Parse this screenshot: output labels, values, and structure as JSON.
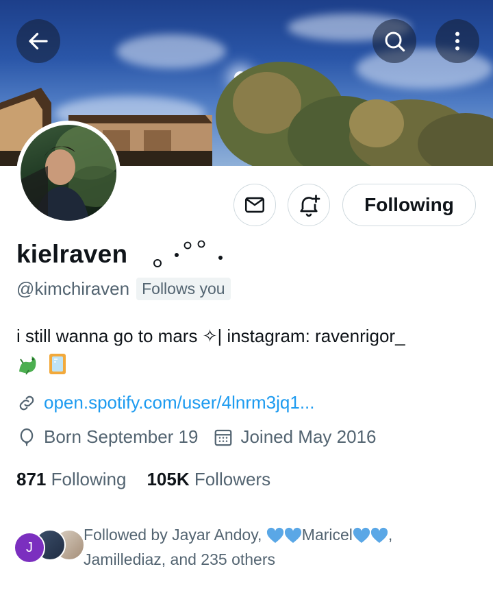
{
  "profile": {
    "display_name": "kielraven",
    "handle": "@kimchiraven",
    "follows_you_label": "Follows you",
    "bio": "i still wanna go to mars ✧| instagram: ravenrigor_",
    "bio_emoji": [
      "dragon",
      "mirror"
    ],
    "link_text": "open.spotify.com/user/4lnrm3jq1...",
    "born": "Born September 19",
    "joined": "Joined May 2016"
  },
  "stats": {
    "following_count": "871",
    "following_label": "Following",
    "followers_count": "105K",
    "followers_label": "Followers"
  },
  "actions": {
    "following_button": "Following",
    "message_icon": "envelope-icon",
    "notify_icon": "bell-plus-icon"
  },
  "header": {
    "back_icon": "arrow-left-icon",
    "search_icon": "search-icon",
    "more_icon": "more-vertical-icon"
  },
  "followed_by": {
    "avatar_initial": "J",
    "prefix": "Followed by Jayar Andoy, ",
    "name2": "Maricel",
    "suffix": ",",
    "line2": "Jamillediaz, and 235 others"
  },
  "colors": {
    "link": "#1d9bf0",
    "secondary_text": "#536471",
    "heart_blue": "#5aa7e6",
    "avatar_j": "#7b2fbf"
  }
}
